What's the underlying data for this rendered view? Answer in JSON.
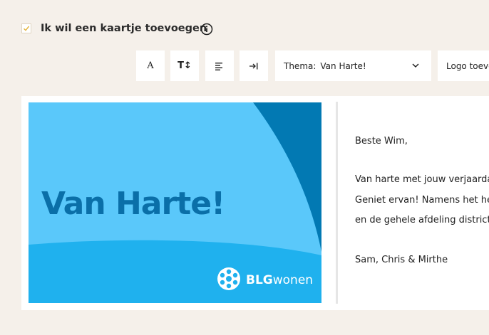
{
  "option": {
    "label": "Ik wil een kaartje toevoegen",
    "checked": true
  },
  "toolbar": {
    "font_button": "A",
    "size_button": "T↕",
    "align_button": "align-left-icon",
    "indent_button": "indent-icon",
    "theme_select": {
      "label": "Thema:",
      "value": "Van Harte!"
    },
    "logo_select": {
      "value": "Logo toevoegen"
    }
  },
  "card": {
    "headline": "Van Harte!",
    "brand_bold": "BLG",
    "brand_light": "wonen",
    "colors": {
      "light_blue": "#5ac8fa",
      "mid_blue": "#1fb1ee",
      "dark_blue": "#0279b3",
      "headline": "#0a6fa8"
    }
  },
  "message": {
    "greeting": "Beste Wim,",
    "line1": "Van harte met jouw verjaardag",
    "line2": "Geniet ervan! Namens het hele",
    "line3": "en de gehele afdeling district",
    "signature": "Sam, Chris & Mirthe"
  }
}
